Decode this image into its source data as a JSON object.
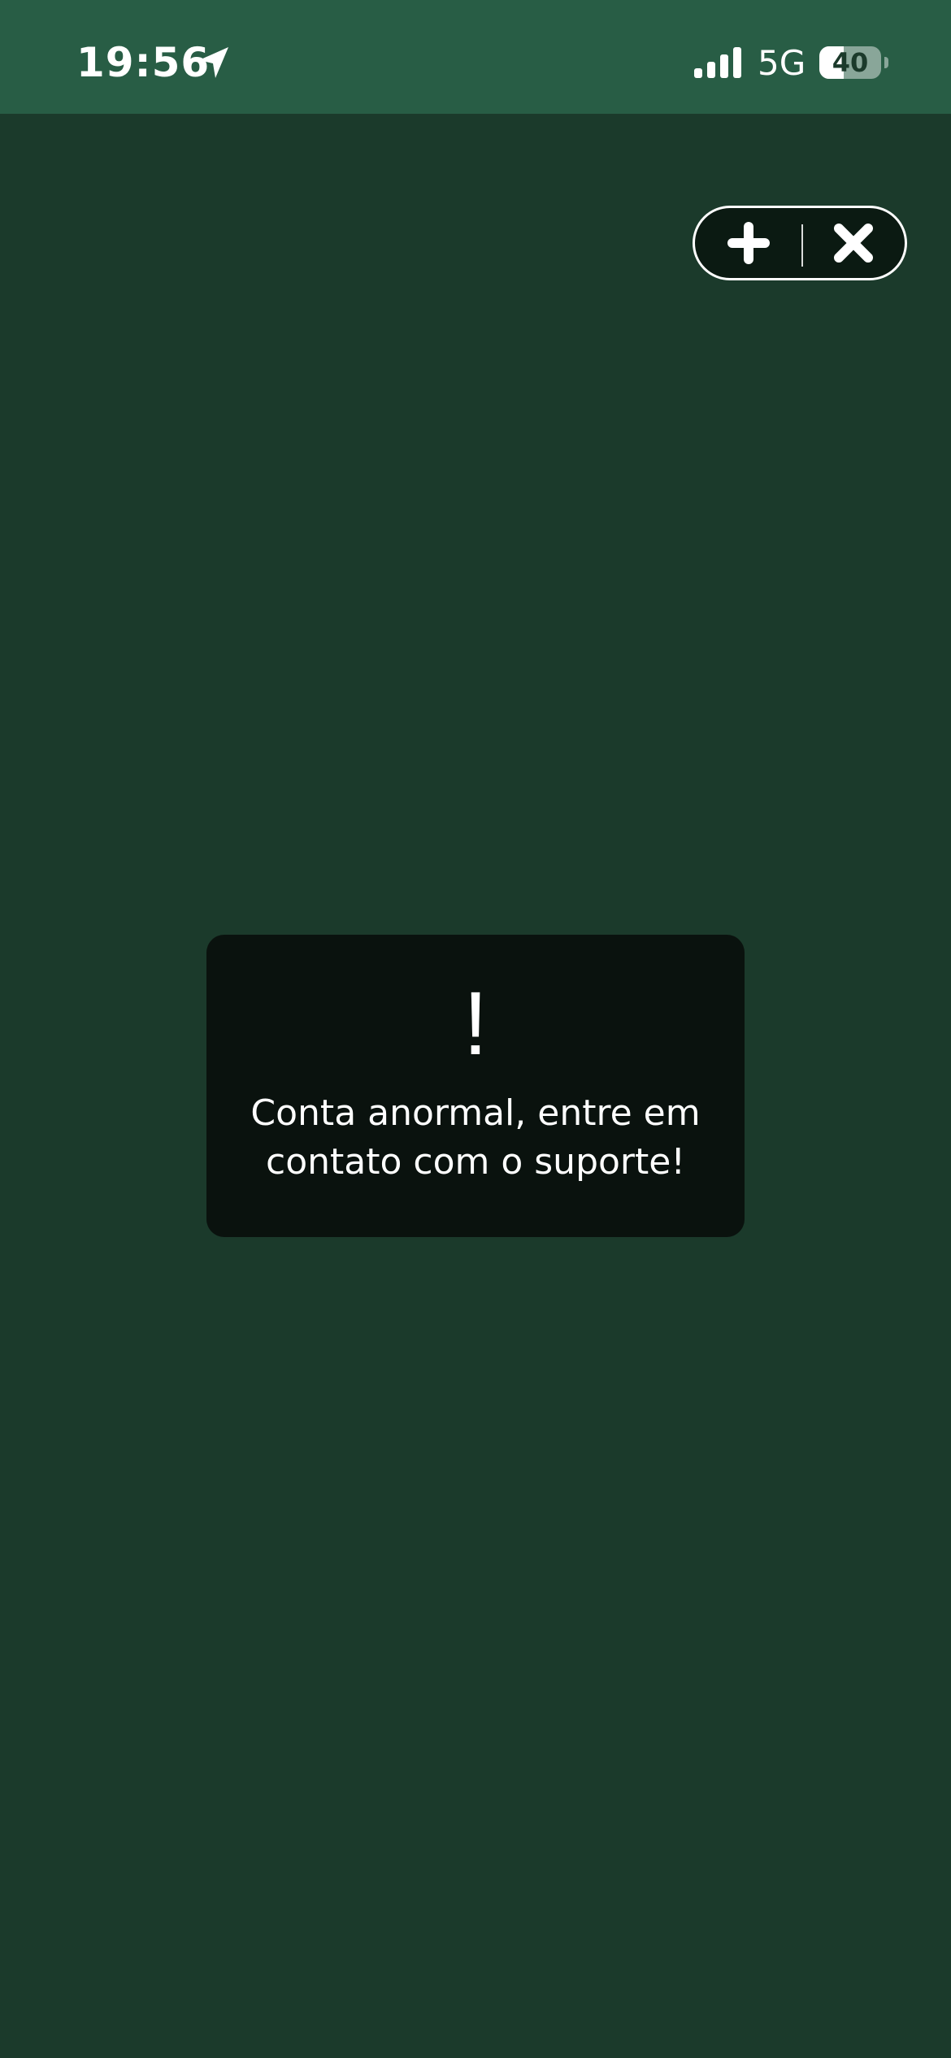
{
  "status_bar": {
    "time": "19:56",
    "location_icon": "location-arrow-icon",
    "signal_icon": "cellular-signal-icon",
    "network": "5G",
    "battery_level": "40",
    "battery_fraction": 0.4
  },
  "capsule": {
    "add_icon": "plus-icon",
    "close_icon": "close-icon"
  },
  "toast": {
    "icon_text": "!",
    "message": "Conta anormal, entre em contato com o suporte!"
  },
  "colors": {
    "background": "#1b3a2b",
    "status_bar": "#285d45",
    "toast_background": "#0a120e",
    "capsule_background": "#0b1a12",
    "text": "#ffffff"
  }
}
